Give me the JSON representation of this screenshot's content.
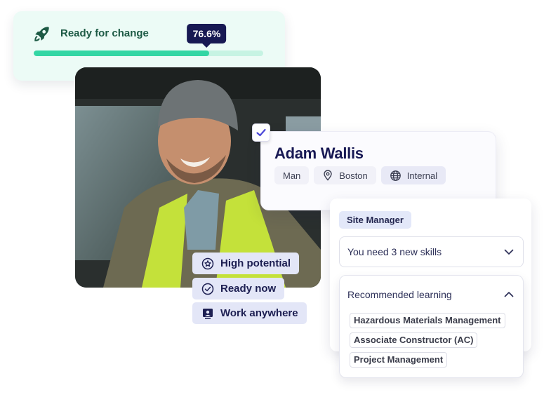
{
  "readiness": {
    "title": "Ready for change",
    "percent_label": "76.6%",
    "percent": 76.6,
    "icon": "rocket-icon",
    "colors": {
      "fill": "#33d6a4",
      "track": "#c6f3e3",
      "title": "#1d5a45",
      "tooltip": "#171953"
    }
  },
  "photo": {
    "alt": "Smiling man in a beanie and hi-vis vest sitting in a vehicle"
  },
  "profile": {
    "selected": true,
    "name": "Adam Wallis",
    "tags": [
      {
        "label": "Man",
        "icon": ""
      },
      {
        "label": "Boston",
        "icon": "location-pin-icon"
      },
      {
        "label": "Internal",
        "icon": "globe-icon"
      }
    ]
  },
  "badges": [
    {
      "label": "High potential",
      "icon": "star-circle-icon"
    },
    {
      "label": "Ready now",
      "icon": "check-circle-icon"
    },
    {
      "label": "Work anywhere",
      "icon": "remote-user-icon"
    }
  ],
  "role": {
    "title": "Site Manager",
    "skills_dropdown": {
      "label": "You need 3 new skills",
      "expanded": false
    },
    "learning": {
      "label": "Recommended learning",
      "expanded": true,
      "courses": [
        "Hazardous Materials Management",
        "Associate Constructor (AC)",
        "Project Management"
      ]
    }
  }
}
